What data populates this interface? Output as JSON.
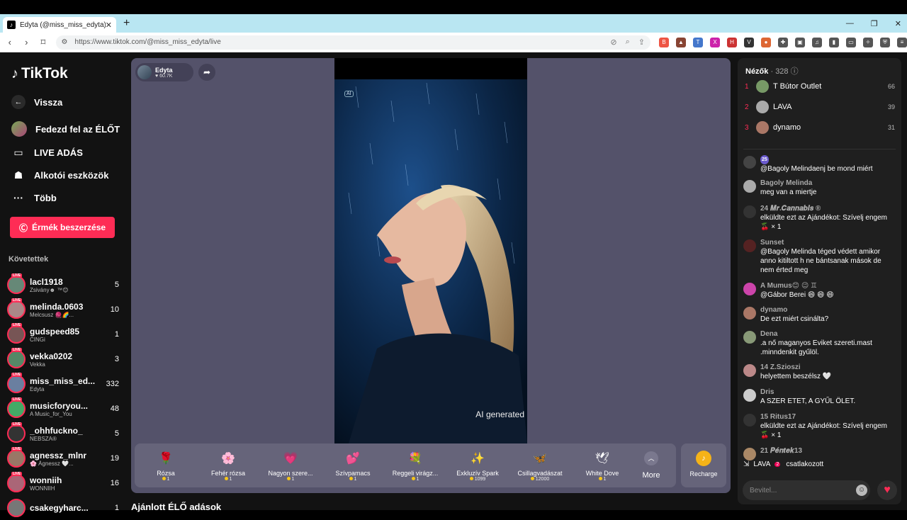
{
  "browser": {
    "tab_title": "Edyta (@miss_miss_edyta) Él...",
    "url": "https://www.tiktok.com/@miss_miss_edyta/live"
  },
  "sidebar": {
    "brand": "TikTok",
    "back": "Vissza",
    "nav": [
      {
        "label": "Fedezd fel az ÉLŐT",
        "icon": "globe-icon"
      },
      {
        "label": "LIVE ADÁS",
        "icon": "camera-icon"
      },
      {
        "label": "Alkotói eszközök",
        "icon": "lightbulb-icon"
      },
      {
        "label": "Több",
        "icon": "more-icon"
      }
    ],
    "coins_button": "Érmék beszerzése",
    "following_title": "Követettek",
    "following": [
      {
        "name": "lacl1918",
        "sub": "Zsivány☻ ™😊",
        "count": "5"
      },
      {
        "name": "melinda.0603",
        "sub": "Melcsusz 🧶🌈...",
        "count": "10"
      },
      {
        "name": "gudspeed85",
        "sub": "CINGi",
        "count": "1"
      },
      {
        "name": "vekka0202",
        "sub": "Vekka",
        "count": "3"
      },
      {
        "name": "miss_miss_ed...",
        "sub": "Edyta",
        "count": "332"
      },
      {
        "name": "musicforyou...",
        "sub": "A Music_for_You",
        "count": "48"
      },
      {
        "name": "_ohhfuckno_",
        "sub": "NEBSZA®",
        "count": "5"
      },
      {
        "name": "agnessz_mlnr",
        "sub": "🌸 Ágnessz 🤍...",
        "count": "19"
      },
      {
        "name": "wonniih",
        "sub": "WONNIIH",
        "count": "16"
      },
      {
        "name": "csakegyharc...",
        "sub": "",
        "count": "1"
      }
    ],
    "live_badge": "LIVE"
  },
  "stage": {
    "host_name": "Edyta",
    "host_likes": "♥ 60.7K",
    "ai_badge": "AI",
    "ai_generated": "AI generated",
    "gifts": [
      {
        "name": "Rózsa",
        "price": "1",
        "icon": "🌹"
      },
      {
        "name": "Fehér rózsa",
        "price": "1",
        "icon": "🌸"
      },
      {
        "name": "Nagyon szere...",
        "price": "1",
        "icon": "💗"
      },
      {
        "name": "Szívpamacs",
        "price": "1",
        "icon": "💕"
      },
      {
        "name": "Reggeli virágz...",
        "price": "1",
        "icon": "💐"
      },
      {
        "name": "Exkluzív Spark",
        "price": "1099",
        "icon": "✨"
      },
      {
        "name": "Csillagvadászat",
        "price": "12000",
        "icon": "🦋"
      },
      {
        "name": "White Dove",
        "price": "1",
        "icon": "🕊"
      }
    ],
    "more": "More",
    "recharge": "Recharge"
  },
  "recommended_title": "Ajánlott ÉLŐ adások",
  "chat": {
    "viewers_label": "Nézők",
    "viewers_count": "· 328",
    "top_viewers": [
      {
        "rank": "1",
        "name": "T Bútor Outlet",
        "score": "66"
      },
      {
        "rank": "2",
        "name": "LAVA",
        "score": "39"
      },
      {
        "rank": "3",
        "name": "dynamo",
        "score": "31"
      }
    ],
    "messages": [
      {
        "user": "25",
        "text": "@Bagoly Melindaenj be mond miért"
      },
      {
        "user": "Bagoly Melinda",
        "text": "meg van a miertje"
      },
      {
        "user": "24 𝑴𝒓.𝑪𝒂𝒏𝒏𝒂𝒃𝒊𝒔 ®",
        "text": "elküldte ezt az Ajándékot: Szívelj engem 🍒 × 1"
      },
      {
        "user": "Sunset",
        "text": "@Bagoly Melinda téged védett amikor anno kitiltott h ne bántsanak mások de nem érted meg"
      },
      {
        "user": "A Mumus😊 😉 ♊",
        "text": "@Gábor Berei 😄 😄 😄"
      },
      {
        "user": "dynamo",
        "text": "De ezt miért csinálta?"
      },
      {
        "user": "Dena",
        "text": ".a nő maganyos Eviket szereti.mast .minndenkit gyűlöl."
      },
      {
        "user": "14 Z.Szioszi",
        "text": "helyettem beszélsz 🤍"
      },
      {
        "user": "Dris",
        "text": "A SZER ETET, A GYŰL ÖLET."
      },
      {
        "user": "15 Ritus17",
        "text": "elküldte ezt az Ajándékot: Szívelj engem 🍒 × 1"
      },
      {
        "user": "21 𝑷𝒆́𝒏𝒕𝒆𝒌13",
        "text": ""
      }
    ],
    "joined_user": "LAVA",
    "joined_level": "2",
    "joined_text": "csatlakozott",
    "input_placeholder": "Bevitel..."
  }
}
